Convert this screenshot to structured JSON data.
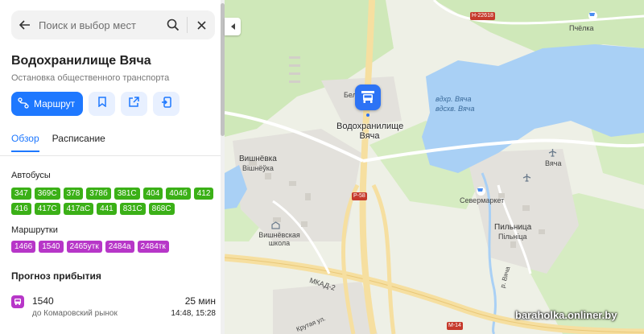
{
  "search": {
    "placeholder": "Поиск и выбор мест"
  },
  "place": {
    "title": "Водохранилище Вяча",
    "subtitle": "Остановка общественного транспорта"
  },
  "actions": {
    "route_label": "Маршрут"
  },
  "tabs": [
    {
      "label": "Обзор",
      "active": true
    },
    {
      "label": "Расписание",
      "active": false
    }
  ],
  "buses": {
    "label": "Автобусы",
    "items": [
      "347",
      "369С",
      "378",
      "378б",
      "381С",
      "404",
      "404б",
      "412",
      "416",
      "417С",
      "417аС",
      "441",
      "831С",
      "868С"
    ]
  },
  "minibuses": {
    "label": "Маршрутки",
    "items": [
      "1466",
      "1540",
      "2465утк",
      "2484а",
      "2484тк"
    ]
  },
  "arrival": {
    "title": "Прогноз прибытия",
    "number": "1540",
    "destination": "до Комаровский рынок",
    "minutes": "25 мин",
    "times": "14:48, 15:28"
  },
  "map": {
    "stop_caption": "Водохранилище Вяча",
    "labels": {
      "vishnevka": "Вишнёвка",
      "vishnevka_be": "Вішнёўка",
      "school": "Вишнёвская школа",
      "severmarket": "Севермаркет",
      "pilnitsa": "Пильница",
      "pilnitsa_be": "Пільніца",
      "vyacha": "Вяча",
      "pchelka": "Пчёлка",
      "water_ru": "вдхр. Вяча",
      "water_be": "вдсхв. Вяча",
      "belarus": "Беларусь",
      "mkad": "МКАД-2",
      "krutaya": "Крутая ул.",
      "river": "р. Вяча"
    },
    "road_signs": {
      "n22618": "Н-22618",
      "p58": "Р-58",
      "m14": "М-14"
    },
    "watermark": "baraholka.onliner.by"
  },
  "colors": {
    "accent": "#1e78ff",
    "bus": "#3bb017",
    "minibus": "#b736c8",
    "water": "#a9d0f5",
    "forest": "#cfe8b9"
  }
}
